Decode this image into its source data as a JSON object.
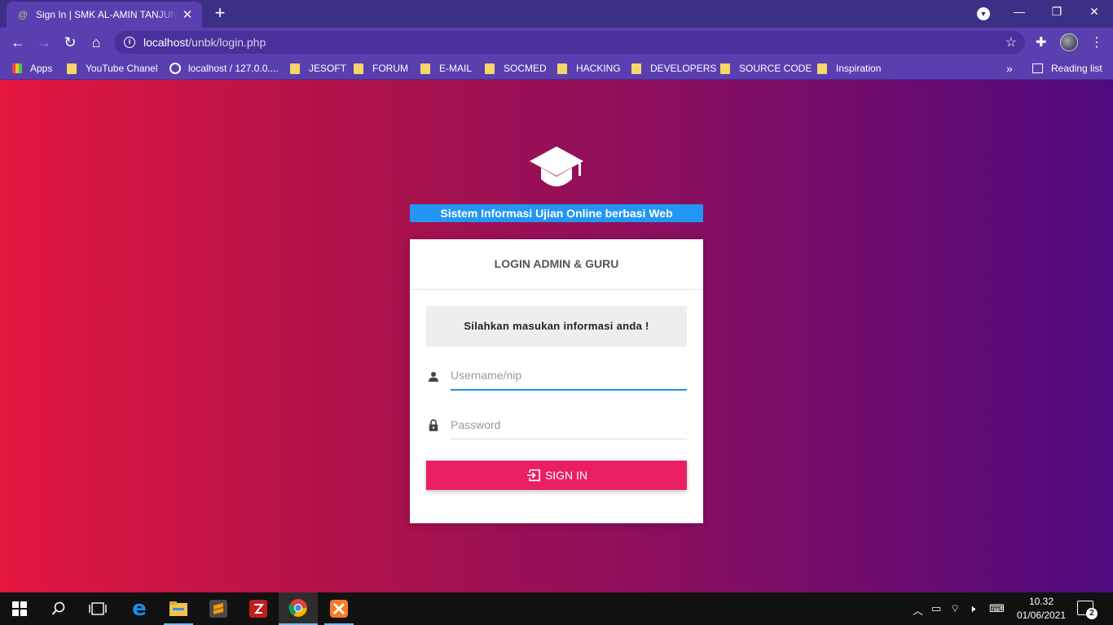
{
  "browser": {
    "tab_title": "Sign In | SMK AL-AMIN TANJUNG",
    "tab_close": "✕",
    "new_tab": "+",
    "url_host": "localhost",
    "url_path": "/unbk/login.php",
    "more_bookmarks": "»",
    "bookmarks": {
      "apps": "Apps",
      "youtube": "YouTube Chanel",
      "localhost": "localhost / 127.0.0....",
      "jesoft": "JESOFT",
      "forum": "FORUM",
      "email": "E-MAIL",
      "socmed": "SOCMED",
      "hacking": "HACKING",
      "developers": "DEVELOPERS",
      "source_code": "SOURCE CODE",
      "inspiration": "Inspiration",
      "reading_list": "Reading list"
    }
  },
  "page": {
    "banner": "Sistem Informasi Ujian Online berbasi Web",
    "card_title": "LOGIN ADMIN & GURU",
    "message": "Silahkan masukan informasi anda !",
    "username_placeholder": "Username/nip",
    "password_placeholder": "Password",
    "signin_label": "SIGN IN"
  },
  "taskbar": {
    "time": "10.32",
    "date": "01/06/2021",
    "notifications": "2"
  },
  "colors": {
    "banner": "#2196f3",
    "signin": "#e91e63",
    "gradient_start": "#e41740",
    "gradient_end": "#4e0a7e",
    "browser_theme": "#5a3fb0"
  }
}
